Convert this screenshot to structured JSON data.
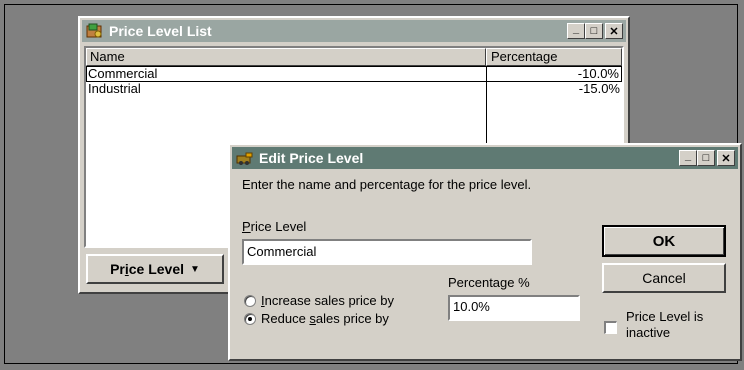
{
  "list_window": {
    "title": "Price Level List",
    "columns": {
      "name": "Name",
      "percentage": "Percentage"
    },
    "rows": [
      {
        "name": "Commercial",
        "percentage": "-10.0%"
      },
      {
        "name": "Industrial",
        "percentage": "-15.0%"
      }
    ],
    "menu_button": {
      "pre": "Pr",
      "key": "i",
      "post": "ce Level",
      "arrow": "▼"
    }
  },
  "edit_dialog": {
    "title": "Edit Price Level",
    "instruction": "Enter the name and percentage for the price level.",
    "price_level_label": {
      "key": "P",
      "rest": "rice Level"
    },
    "price_level_value": "Commercial",
    "percentage_label": "Percentage %",
    "percentage_value": "10.0%",
    "increase_option": {
      "key": "I",
      "rest": "ncrease sales price by"
    },
    "reduce_option": {
      "pre": "Reduce ",
      "key": "s",
      "rest": "ales price by"
    },
    "selected_option": "reduce",
    "ok_label": "OK",
    "cancel_label": "Cancel",
    "inactive_line1": "Price Level is",
    "inactive_line2": "inactive",
    "inactive_checked": false
  },
  "window_buttons": {
    "minimize": "_",
    "maximize": "□",
    "close": "✕"
  }
}
